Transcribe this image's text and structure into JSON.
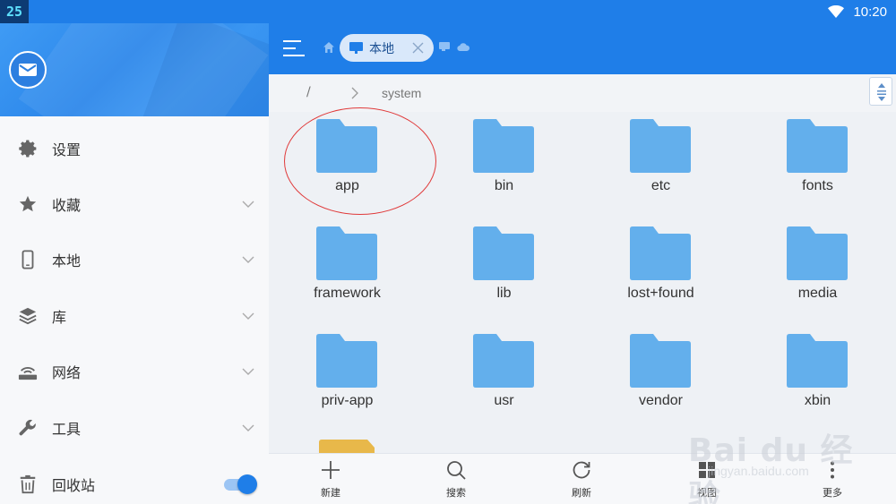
{
  "status_bar": {
    "badge": "25",
    "time": "10:20"
  },
  "sidebar": {
    "items": [
      {
        "label": "设置",
        "icon": "gear-icon",
        "chevron": false
      },
      {
        "label": "收藏",
        "icon": "star-icon",
        "chevron": true
      },
      {
        "label": "本地",
        "icon": "phone-icon",
        "chevron": true
      },
      {
        "label": "库",
        "icon": "layers-icon",
        "chevron": true
      },
      {
        "label": "网络",
        "icon": "network-icon",
        "chevron": true
      },
      {
        "label": "工具",
        "icon": "wrench-icon",
        "chevron": true
      },
      {
        "label": "回收站",
        "icon": "trash-icon",
        "toggle_on": true
      }
    ]
  },
  "toolbar": {
    "tab_label": "本地"
  },
  "path": {
    "root": "/",
    "current": "system"
  },
  "folders": [
    "app",
    "bin",
    "etc",
    "fonts",
    "framework",
    "lib",
    "lost+found",
    "media",
    "priv-app",
    "usr",
    "vendor",
    "xbin"
  ],
  "bottom_bar": {
    "new": "新建",
    "search": "搜索",
    "refresh": "刷新",
    "view": "视图",
    "more": "更多"
  },
  "watermark": {
    "brand": "Bai du 经验",
    "url": "jingyan.baidu.com"
  },
  "colors": {
    "accent": "#1f7ee8",
    "folder": "#63afec",
    "highlight": "#e03a3a"
  }
}
